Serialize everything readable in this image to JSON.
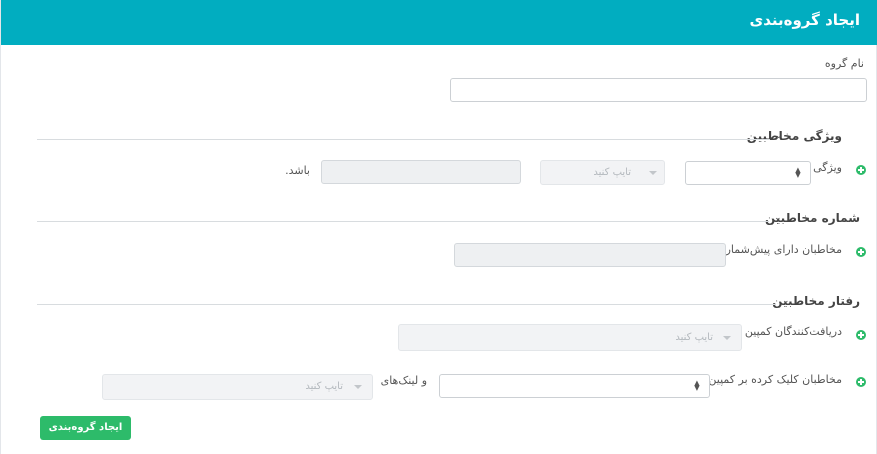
{
  "header": {
    "title": "ایجاد گروه‌بندی"
  },
  "group_name": {
    "label": "نام گروه",
    "value": ""
  },
  "sections": {
    "features": {
      "title": "ویژگی مخاطبین"
    },
    "number": {
      "title": "شماره مخاطبین"
    },
    "behavior": {
      "title": "رفتار مخاطبین"
    }
  },
  "rows": {
    "feature": {
      "label": "ویژگی",
      "type_placeholder": "تایپ کنید",
      "suffix": "باشد."
    },
    "prefix": {
      "label": "مخاطبان دارای پیش‌شماره"
    },
    "receivers": {
      "label": "دریافت‌کنندگان کمپین",
      "type_placeholder": "تایپ کنید"
    },
    "clickers": {
      "label": "مخاطبان کلیک کرده بر کمپین",
      "links_label": "و لینک‌های",
      "type_placeholder": "تایپ کنید"
    }
  },
  "submit": {
    "label": "ایجاد گروه‌بندی"
  },
  "colors": {
    "header": "#01adc0",
    "accent_green": "#2dbb6a"
  },
  "icons": {
    "add": "plus-circle-icon",
    "chevron": "chevron-down-icon",
    "caret": "caret-down-icon",
    "spinner": "up-down-arrows-icon"
  }
}
